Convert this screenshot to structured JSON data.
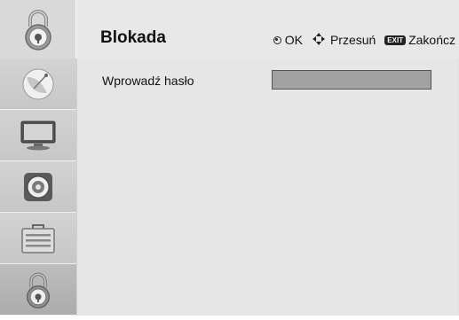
{
  "header": {
    "title": "Blokada",
    "hints": {
      "ok_label": "OK",
      "move_label": "Przesuń",
      "exit_badge": "EXIT",
      "exit_label": "Zakończ"
    }
  },
  "sidebar": {
    "items": [
      {
        "name": "satellite-dish-icon",
        "active": false
      },
      {
        "name": "tv-monitor-icon",
        "active": false
      },
      {
        "name": "speaker-icon",
        "active": false
      },
      {
        "name": "toolbox-icon",
        "active": false
      },
      {
        "name": "padlock-icon",
        "active": true
      }
    ]
  },
  "content": {
    "password_label": "Wprowadź hasło",
    "password_value": ""
  },
  "colors": {
    "header_bg": "#e8e8e8",
    "content_bg": "#e6e6e6",
    "sidebar_bg": "#cccccc",
    "active_bg": "#b3b3b3",
    "field_bg": "#a2a2a2"
  }
}
